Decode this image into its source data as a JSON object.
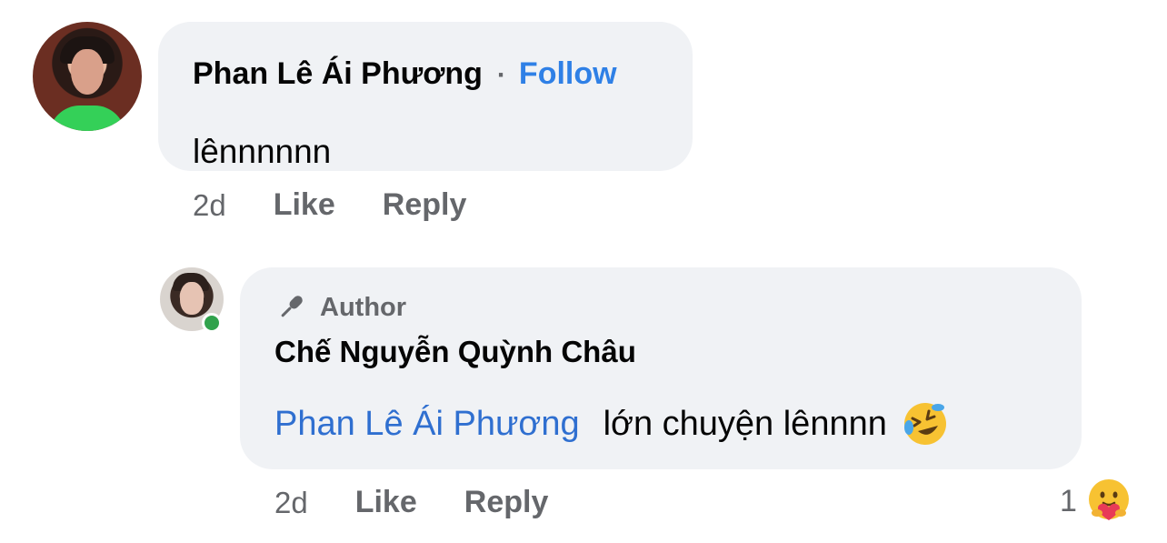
{
  "comment": {
    "author": "Phan Lê Ái Phương",
    "separator": "·",
    "follow_label": "Follow",
    "text": "lênnnnnn",
    "timestamp": "2d",
    "like_label": "Like",
    "reply_label": "Reply"
  },
  "reply": {
    "badge_label": "Author",
    "author": "Chế Nguyễn Quỳnh Châu",
    "mention": "Phan Lê Ái Phương",
    "text": "lớn chuyện lênnnn",
    "emoji": "rolling-on-the-floor-laughing",
    "timestamp": "2d",
    "like_label": "Like",
    "reply_label": "Reply",
    "reaction_count": "1",
    "reaction_type": "care"
  },
  "colors": {
    "bubble": "#f0f2f5",
    "link": "#2f80e6",
    "muted": "#65676b",
    "online": "#31a24c"
  }
}
